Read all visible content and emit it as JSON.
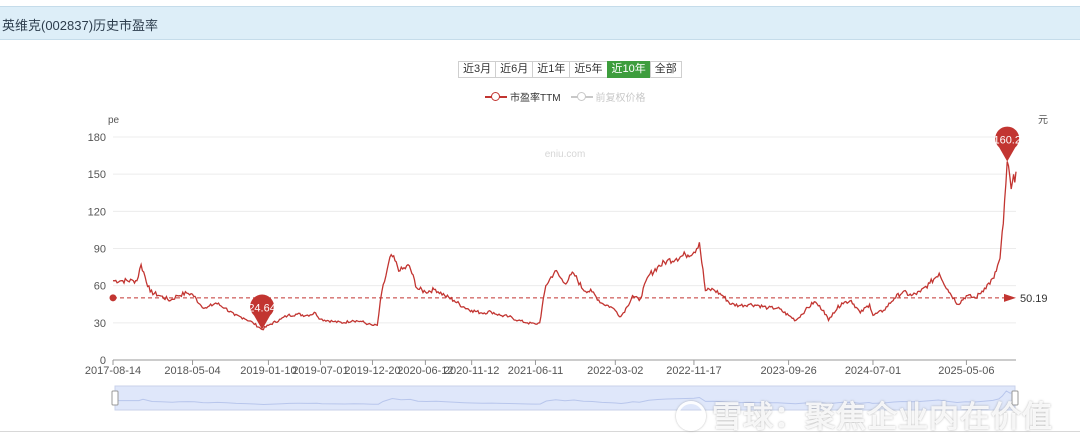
{
  "header": {
    "title": "英维克(002837)历史市盈率"
  },
  "ranges": [
    "近3月",
    "近6月",
    "近1年",
    "近5年",
    "近10年",
    "全部"
  ],
  "active_range": "近10年",
  "legend": [
    {
      "label": "市盈率TTM",
      "color": "#c23531"
    },
    {
      "label": "前复权价格",
      "color": "#c8c8c8"
    }
  ],
  "watermark_site": "eniu.com",
  "watermark_brand": "雪球：聚焦企业内在价值",
  "colors": {
    "accent": "#c23531",
    "active": "#3d9d3d",
    "header_bg": "#ddeef8"
  },
  "chart_data": {
    "type": "line",
    "ylabel": "pe",
    "y2label": "元",
    "ylim": [
      0,
      180
    ],
    "yticks": [
      0,
      30,
      60,
      90,
      120,
      150,
      180
    ],
    "xlim": [
      "2017-08-14",
      "2025-10-17"
    ],
    "xticks": [
      "2017-08-14",
      "2018-05-04",
      "2019-01-10",
      "2019-07-01",
      "2019-12-20",
      "2020-06-12",
      "2020-11-12",
      "2021-06-11",
      "2022-03-02",
      "2022-11-17",
      "2023-09-26",
      "2024-07-01",
      "2025-05-06"
    ],
    "average": {
      "value": 50.19,
      "label": "50.19"
    },
    "markers": [
      {
        "type": "min",
        "date": "2018-12-20",
        "value": 24.64,
        "label": "24.64"
      },
      {
        "type": "max",
        "date": "2025-09-18",
        "value": 160.2,
        "label": "160.2"
      }
    ],
    "series": [
      {
        "name": "市盈率TTM",
        "x": [
          "2017-08-14",
          "2017-09-15",
          "2017-10-20",
          "2017-11-01",
          "2017-11-15",
          "2017-12-15",
          "2018-01-15",
          "2018-02-20",
          "2018-03-15",
          "2018-04-15",
          "2018-05-04",
          "2018-06-01",
          "2018-06-20",
          "2018-07-20",
          "2018-08-20",
          "2018-09-20",
          "2018-10-20",
          "2018-11-20",
          "2018-12-20",
          "2019-01-10",
          "2019-02-20",
          "2019-03-15",
          "2019-04-15",
          "2019-05-15",
          "2019-06-15",
          "2019-07-01",
          "2019-08-15",
          "2019-09-15",
          "2019-10-15",
          "2019-11-15",
          "2019-12-05",
          "2019-12-20",
          "2020-01-05",
          "2020-01-20",
          "2020-02-20",
          "2020-03-20",
          "2020-04-20",
          "2020-05-15",
          "2020-06-12",
          "2020-07-15",
          "2020-08-15",
          "2020-09-15",
          "2020-10-15",
          "2020-11-12",
          "2020-12-15",
          "2021-01-15",
          "2021-02-15",
          "2021-03-15",
          "2021-04-15",
          "2021-05-15",
          "2021-06-11",
          "2021-06-25",
          "2021-07-15",
          "2021-08-15",
          "2021-09-15",
          "2021-10-15",
          "2021-11-15",
          "2021-12-15",
          "2022-01-15",
          "2022-02-15",
          "2022-03-02",
          "2022-03-20",
          "2022-04-10",
          "2022-04-28",
          "2022-05-20",
          "2022-06-20",
          "2022-07-20",
          "2022-08-20",
          "2022-09-20",
          "2022-10-20",
          "2022-11-17",
          "2022-12-05",
          "2022-12-25",
          "2023-01-20",
          "2023-02-20",
          "2023-03-20",
          "2023-04-20",
          "2023-05-20",
          "2023-06-20",
          "2023-07-20",
          "2023-08-20",
          "2023-09-26",
          "2023-10-20",
          "2023-11-20",
          "2023-12-20",
          "2024-01-20",
          "2024-02-05",
          "2024-02-20",
          "2024-03-20",
          "2024-04-20",
          "2024-05-20",
          "2024-06-20",
          "2024-07-01",
          "2024-08-05",
          "2024-09-10",
          "2024-10-08",
          "2024-11-05",
          "2024-12-05",
          "2025-01-05",
          "2025-02-05",
          "2025-03-05",
          "2025-04-08",
          "2025-05-06",
          "2025-06-05",
          "2025-07-05",
          "2025-08-05",
          "2025-08-25",
          "2025-09-05",
          "2025-09-18",
          "2025-10-01",
          "2025-10-17"
        ],
        "values": [
          64,
          64,
          64,
          64,
          77,
          55,
          52,
          48,
          52,
          54,
          53,
          44,
          42,
          46,
          42,
          36,
          34,
          30,
          24.64,
          28,
          33,
          36,
          37,
          36,
          38,
          33,
          31,
          30,
          32,
          31,
          29,
          28,
          28,
          55,
          85,
          72,
          76,
          58,
          55,
          57,
          52,
          48,
          43,
          40,
          38,
          39,
          36,
          35,
          32,
          30,
          29,
          30,
          60,
          72,
          62,
          70,
          57,
          55,
          46,
          43,
          40,
          35,
          43,
          52,
          48,
          68,
          75,
          80,
          82,
          85,
          87,
          95,
          56,
          57,
          52,
          45,
          44,
          45,
          44,
          42,
          42,
          36,
          32,
          40,
          47,
          40,
          32,
          38,
          46,
          48,
          38,
          45,
          36,
          40,
          50,
          55,
          52,
          55,
          62,
          70,
          57,
          45,
          52,
          50,
          58,
          66,
          82,
          110,
          160.2,
          138,
          152
        ]
      }
    ]
  }
}
